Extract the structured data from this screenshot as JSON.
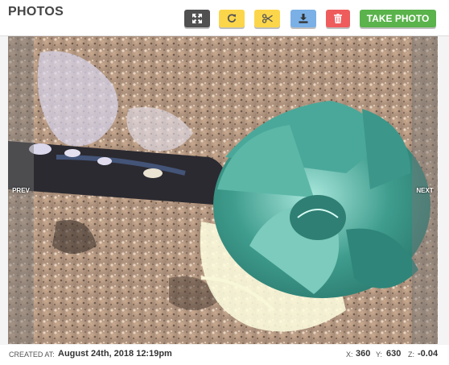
{
  "header": {
    "title": "PHOTOS",
    "buttons": {
      "expand_icon": "expand-icon",
      "rotate_icon": "rotate-icon",
      "crop_icon": "scissors-icon",
      "download_icon": "download-icon",
      "delete_icon": "trash-icon",
      "take_photo_label": "TAKE PHOTO"
    }
  },
  "viewer": {
    "prev_label": "PREV",
    "next_label": "NEXT",
    "photo_description_icon": "plant-photo"
  },
  "footer": {
    "created_label": "CREATED AT:",
    "created_value": "August 24th, 2018 12:19pm",
    "x_label": "X:",
    "x_value": "360",
    "y_label": "Y:",
    "y_value": "630",
    "z_label": "Z:",
    "z_value": "-0.04"
  },
  "colors": {
    "expand_button": "#505050",
    "rotate_button": "#fcd64a",
    "crop_button": "#fcd64a",
    "download_button": "#7ab0e6",
    "delete_button": "#ef5c5c",
    "take_photo_button": "#5ab34b"
  }
}
